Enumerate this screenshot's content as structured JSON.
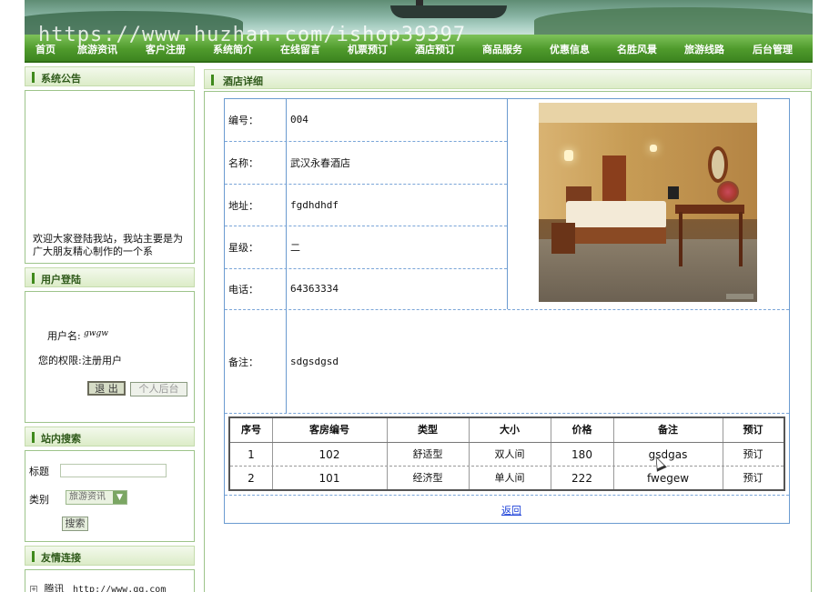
{
  "watermark": "https://www.huzhan.com/ishop39397",
  "nav": [
    "首页",
    "旅游资讯",
    "客户注册",
    "系统简介",
    "在线留言",
    "机票预订",
    "酒店预订",
    "商品服务",
    "优惠信息",
    "名胜风景",
    "旅游线路",
    "后台管理"
  ],
  "sidebar": {
    "notice": {
      "title": "系统公告",
      "text": "欢迎大家登陆我站，我站主要是为广大朋友精心制作的一个系"
    },
    "login": {
      "title": "用户登陆",
      "username_label": "用户名:",
      "username_value": "gwgw",
      "permission_label": "您的权限:",
      "permission_value": "注册用户",
      "logout_label": "退 出",
      "personal_label": "个人后台"
    },
    "search": {
      "title": "站内搜索",
      "title_label": "标题",
      "category_label": "类别",
      "category_value": "旅游资讯",
      "search_label": "搜索"
    },
    "links": {
      "title": "友情连接",
      "items": [
        {
          "name": "腾讯",
          "url": "http://www.qq.com"
        }
      ]
    }
  },
  "main": {
    "title": "酒店详细",
    "fields": [
      {
        "key": "编号：",
        "value": "004"
      },
      {
        "key": "名称：",
        "value": "武汉永春酒店"
      },
      {
        "key": "地址：",
        "value": "fgdhdhdf"
      },
      {
        "key": "星级：",
        "value": "二"
      },
      {
        "key": "电话：",
        "value": "64363334"
      },
      {
        "key": "备注：",
        "value": "sdgsdgsd"
      }
    ],
    "rooms": {
      "headers": [
        "序号",
        "客房编号",
        "类型",
        "大小",
        "价格",
        "备注",
        "预订"
      ],
      "rows": [
        [
          "1",
          "102",
          "舒适型",
          "双人间",
          "180",
          "gsdgas",
          "预订"
        ],
        [
          "2",
          "101",
          "经济型",
          "单人间",
          "222",
          "fwegew",
          "预订"
        ]
      ]
    },
    "back_label": "返回"
  }
}
